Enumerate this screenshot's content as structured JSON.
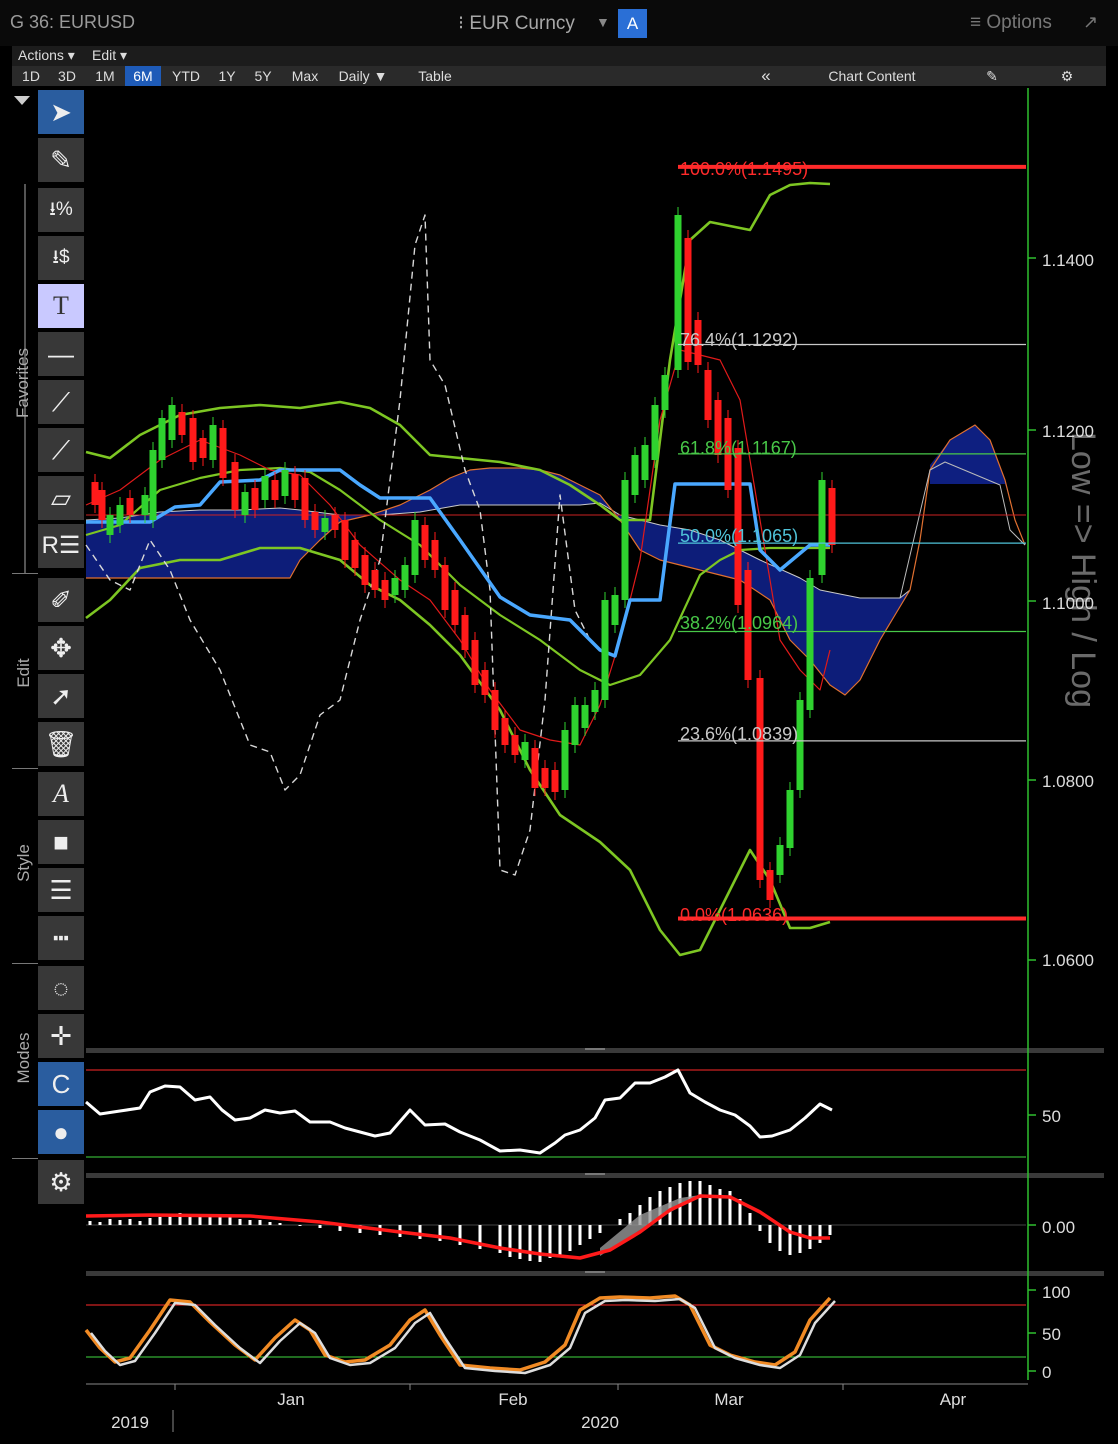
{
  "window": {
    "title": "G 36: EURUSD",
    "security": "⁝ EUR Curncy",
    "security_dropdown": "▼",
    "pane_button": "A",
    "options": "≡ Options",
    "expand": "↗"
  },
  "menu": {
    "actions": "Actions ▾",
    "edit": "Edit ▾"
  },
  "toolbar": {
    "periods": [
      "1D",
      "3D",
      "1M",
      "6M",
      "YTD",
      "1Y",
      "5Y",
      "Max"
    ],
    "selected_period": "6M",
    "interval": "Daily ▼",
    "table": "Table",
    "collapse": "«",
    "chart_content": "Chart Content",
    "edit_icon": "✎",
    "settings_icon": "⚙"
  },
  "left_tools": {
    "groups": [
      "Favorites",
      "Edit",
      "Style",
      "Modes"
    ],
    "icons": [
      "pointer-icon",
      "pencil-icon",
      "percent-icon",
      "dollar-icon",
      "text-icon",
      "line-icon",
      "trendline-icon",
      "segment-icon",
      "channel-icon",
      "r-icon",
      "pen-icon",
      "move-icon",
      "add-point-icon",
      "trash-icon",
      "font-icon",
      "fill-icon",
      "line-width-icon",
      "line-style-icon",
      "lasso-icon",
      "crosshair-icon",
      "magnet-icon",
      "color-icon",
      "gear-icon"
    ]
  },
  "chart_data": {
    "type": "line",
    "title": "",
    "scale_label": "Low => High / Log",
    "price_axis": {
      "ticks": [
        "1.1400",
        "1.1200",
        "1.1000",
        "1.0800",
        "1.0600"
      ]
    },
    "time_axis": {
      "months": [
        "Jan",
        "Feb",
        "Mar",
        "Apr"
      ],
      "years": [
        "2019",
        "2020"
      ]
    },
    "fibonacci": [
      {
        "label": "100.0%(1.1495)",
        "color": "#ff2a2a",
        "value": 1.1495
      },
      {
        "label": "76.4%(1.1292)",
        "color": "#c8c8c8",
        "value": 1.1292
      },
      {
        "label": "61.8%(1.1167)",
        "color": "#48c848",
        "value": 1.1167
      },
      {
        "label": "50.0%(1.1065)",
        "color": "#4fc3d9",
        "value": 1.1065
      },
      {
        "label": "38.2%(1.0964)",
        "color": "#48c848",
        "value": 1.0964
      },
      {
        "label": "23.6%(1.0839)",
        "color": "#c8c8c8",
        "value": 1.0839
      },
      {
        "label": "0.0%(1.0636)",
        "color": "#ff2a2a",
        "value": 1.0636
      }
    ],
    "rsi": {
      "ticks": [
        "50"
      ]
    },
    "macd": {
      "ticks": [
        "0.00"
      ]
    },
    "stochastic": {
      "ticks": [
        "100",
        "50",
        "0"
      ]
    }
  }
}
